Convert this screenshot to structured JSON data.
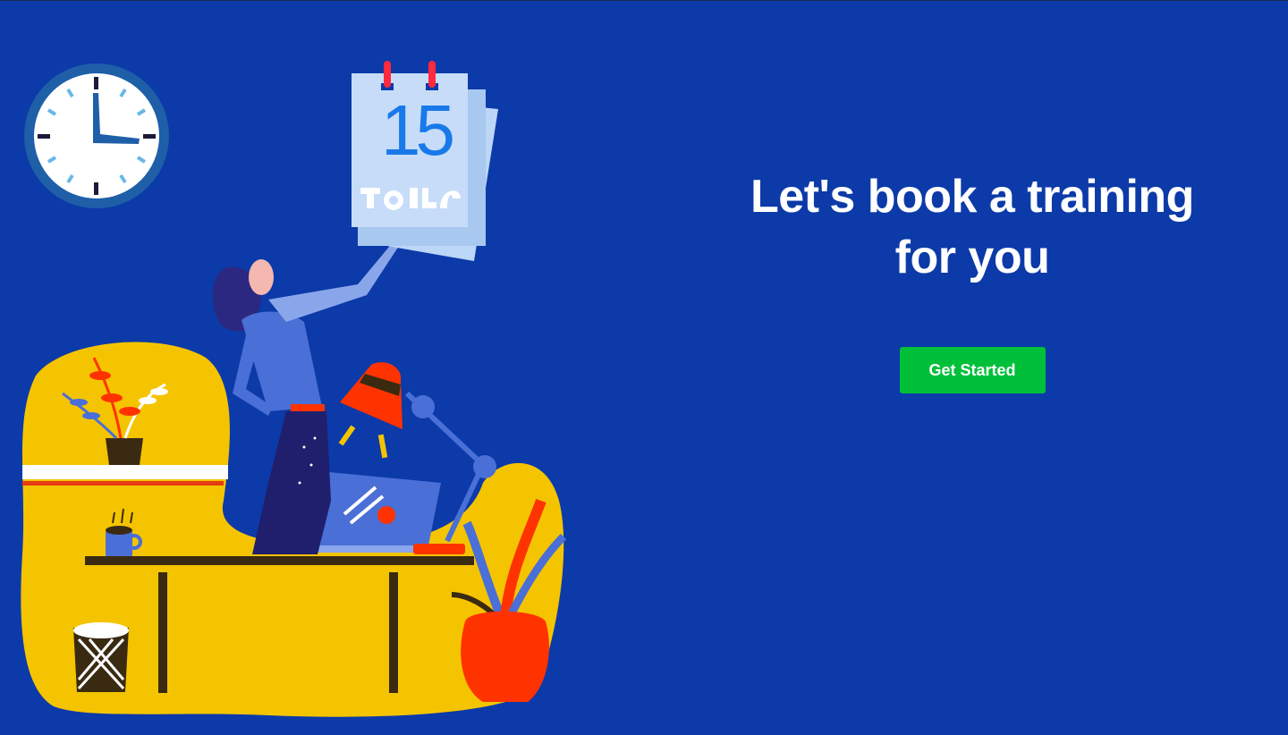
{
  "hero": {
    "title_line1": "Let's book a training",
    "title_line2": "for you",
    "cta_label": "Get Started"
  },
  "calendar": {
    "day": "15"
  },
  "colors": {
    "background": "#0c3aa8",
    "cta": "#00c03a",
    "accent_yellow": "#f5c400",
    "accent_red": "#ff3300"
  },
  "icons": [
    "clock-icon",
    "calendar-icon",
    "woman-figure",
    "desk-lamp",
    "laptop-icon",
    "plant-icon",
    "coffee-cup-icon",
    "wastebasket-icon"
  ]
}
